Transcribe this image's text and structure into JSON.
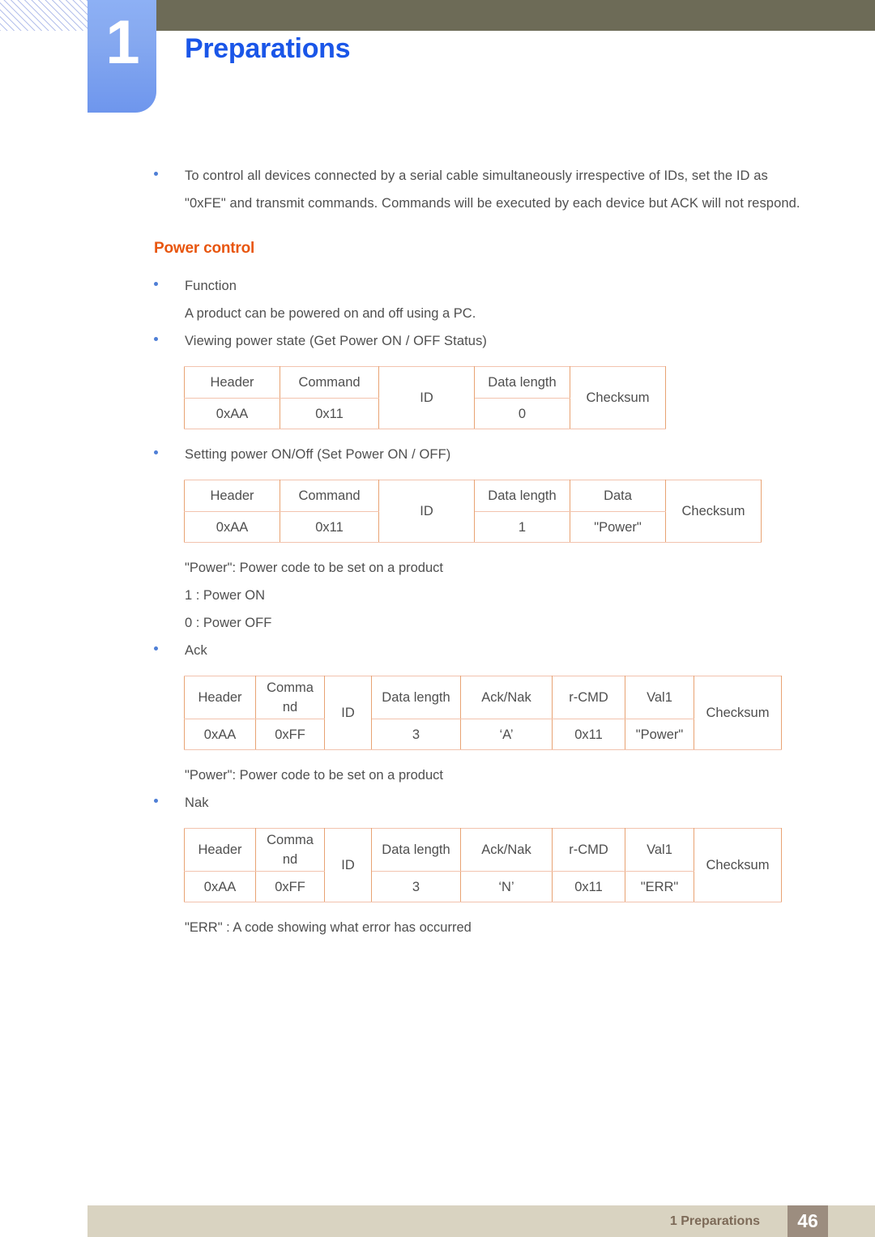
{
  "header": {
    "chapter_number": "1",
    "chapter_title": "Preparations",
    "accent_blue": "#1a56e8",
    "tab_blue": "#86a9f0",
    "bar_olive": "#6d6b57"
  },
  "content": {
    "note_bullet": "To control all devices connected by a serial cable simultaneously irrespective of IDs, set the ID as \"0xFE\" and transmit commands. Commands will be executed by each device but ACK will not respond.",
    "section_title": "Power control",
    "section_title_color": "#e8560f",
    "function_label": "Function",
    "function_desc": "A product can be powered on and off using a PC.",
    "viewing_label": "Viewing power state (Get Power ON / OFF Status)",
    "setting_label": "Setting power ON/Off (Set Power ON / OFF)",
    "power_note": "\"Power\": Power code to be set on a product",
    "power_on": "1 : Power ON",
    "power_off": "0 : Power OFF",
    "ack_label": "Ack",
    "ack_note": "\"Power\": Power code to be set on a product",
    "nak_label": "Nak",
    "nak_note": "\"ERR\" : A code showing what error has occurred"
  },
  "tables": {
    "get_power_status": {
      "headers": [
        "Header",
        "Command",
        "ID",
        "Data length",
        "Checksum"
      ],
      "values": [
        "0xAA",
        "0x11",
        "",
        "0",
        ""
      ]
    },
    "set_power": {
      "headers": [
        "Header",
        "Command",
        "ID",
        "Data length",
        "Data",
        "Checksum"
      ],
      "values": [
        "0xAA",
        "0x11",
        "",
        "1",
        "\"Power\"",
        ""
      ]
    },
    "ack": {
      "headers": [
        "Header",
        "Comma nd",
        "ID",
        "Data length",
        "Ack/Nak",
        "r-CMD",
        "Val1",
        "Checksum"
      ],
      "values": [
        "0xAA",
        "0xFF",
        "",
        "3",
        "‘A’",
        "0x11",
        "\"Power\"",
        ""
      ]
    },
    "nak": {
      "headers": [
        "Header",
        "Comma nd",
        "ID",
        "Data length",
        "Ack/Nak",
        "r-CMD",
        "Val1",
        "Checksum"
      ],
      "values": [
        "0xAA",
        "0xFF",
        "",
        "3",
        "‘N’",
        "0x11",
        "\"ERR\"",
        ""
      ]
    }
  },
  "footer": {
    "label": "1 Preparations",
    "page_number": "46",
    "bar_color": "#d9d3c1",
    "page_box_color": "#9c8d7f"
  }
}
